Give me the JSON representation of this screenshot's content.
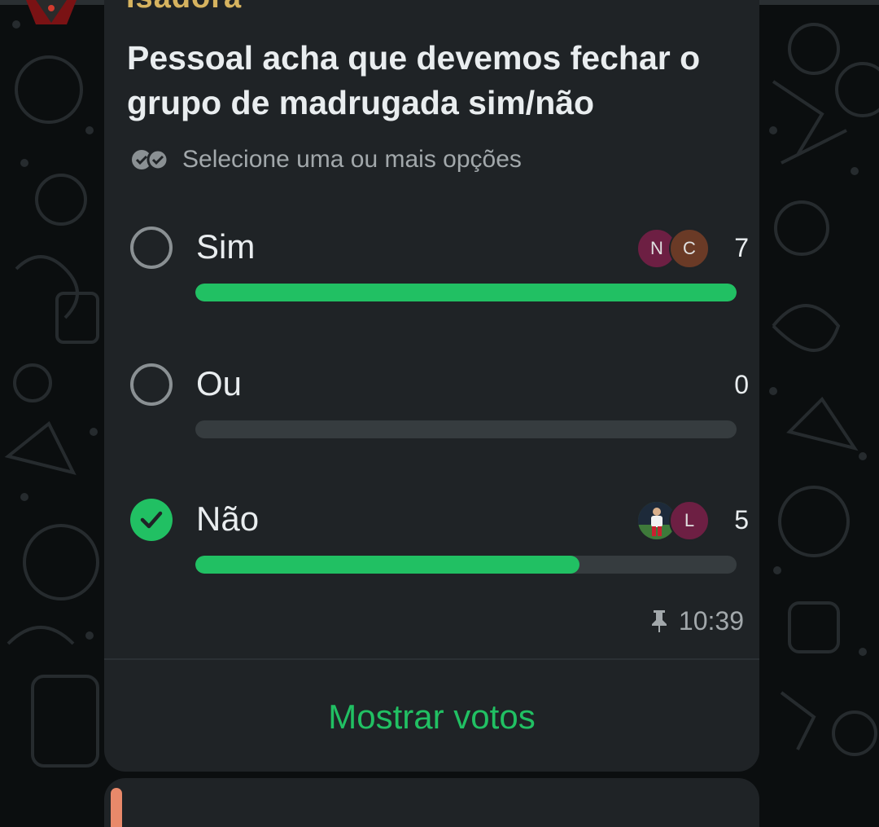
{
  "chat": {
    "sender_name": "Isadora",
    "poll": {
      "question": "Pessoal acha que devemos fechar o grupo de madrugada sim/não",
      "multi_select_hint": "Selecione uma ou mais opções",
      "options": [
        {
          "label": "Sim",
          "votes": "7",
          "selected": false,
          "fill_fraction": 1.0,
          "voters": [
            {
              "initial": "N",
              "color": "#6d1f43"
            },
            {
              "initial": "C",
              "color": "#6a3a26"
            }
          ]
        },
        {
          "label": "Ou",
          "votes": "0",
          "selected": false,
          "fill_fraction": 0.0,
          "voters": []
        },
        {
          "label": "Não",
          "votes": "5",
          "selected": true,
          "fill_fraction": 0.71,
          "voters": [
            {
              "initial": "",
              "color": "#3b5a3c",
              "photo": true
            },
            {
              "initial": "L",
              "color": "#6d1f43"
            }
          ]
        }
      ],
      "time": "10:39",
      "pinned_icon": "pin-icon",
      "show_votes_label": "Mostrar votos"
    }
  },
  "colors": {
    "accent": "#21c063",
    "bubble": "#1f2326",
    "text_primary": "#e9edef",
    "text_secondary": "#a2a8ab"
  }
}
